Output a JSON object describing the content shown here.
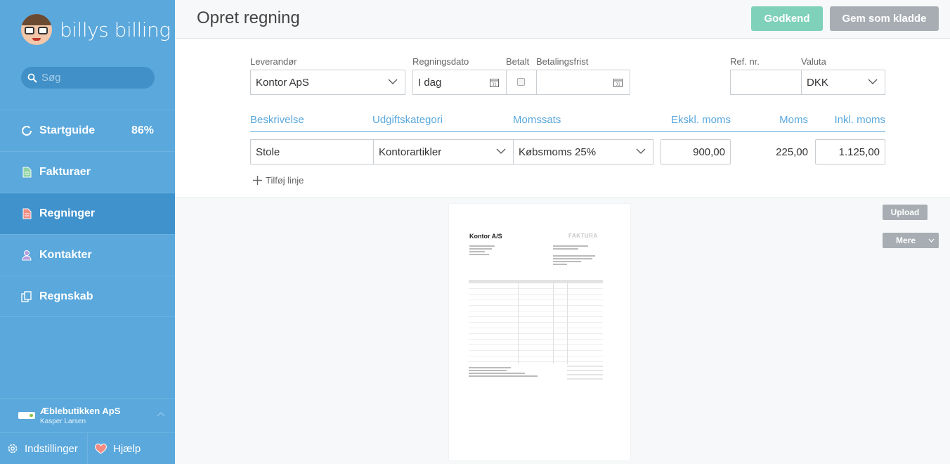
{
  "app": {
    "logo_text": "billys billing",
    "search_placeholder": "Søg"
  },
  "sidebar": {
    "items": [
      {
        "label": "Startguide",
        "badge": "86%",
        "icon": "circle-progress-icon"
      },
      {
        "label": "Fakturaer",
        "icon": "document-green-icon"
      },
      {
        "label": "Regninger",
        "icon": "document-red-icon",
        "active": true
      },
      {
        "label": "Kontakter",
        "icon": "person-icon"
      },
      {
        "label": "Regnskab",
        "icon": "ledger-icon"
      }
    ],
    "organization": {
      "name": "Æblebutikken ApS",
      "user": "Kasper Larsen"
    },
    "bottom": {
      "settings_label": "Indstillinger",
      "help_label": "Hjælp"
    }
  },
  "header": {
    "title": "Opret regning",
    "approve_label": "Godkend",
    "draft_label": "Gem som kladde"
  },
  "form": {
    "vendor_label": "Leverandør",
    "vendor_value": "Kontor ApS",
    "date_label": "Regningsdato",
    "date_value": "I dag",
    "paid_label": "Betalt",
    "due_label": "Betalingsfrist",
    "due_value": "",
    "ref_label": "Ref. nr.",
    "ref_value": "",
    "currency_label": "Valuta",
    "currency_value": "DKK"
  },
  "lines": {
    "headers": {
      "description": "Beskrivelse",
      "category": "Udgiftskategori",
      "vat_rate": "Momssats",
      "excl": "Ekskl. moms",
      "vat": "Moms",
      "incl": "Inkl. moms"
    },
    "rows": [
      {
        "description": "Stole",
        "category": "Kontorartikler",
        "vat_rate": "Købsmoms 25%",
        "excl": "900,00",
        "vat": "225,00",
        "incl": "1.125,00"
      }
    ],
    "add_label": "Tilføj linje"
  },
  "attachment": {
    "company": "Kontor A/S",
    "doc_title": "FAKTURA",
    "upload_label": "Upload",
    "more_label": "Mere"
  },
  "colors": {
    "sidebar": "#5aa8dc",
    "sidebar_active": "#3f92cc",
    "approve": "#7fd1b9",
    "secondary": "#a7adb3",
    "accent": "#5aa8dc"
  }
}
